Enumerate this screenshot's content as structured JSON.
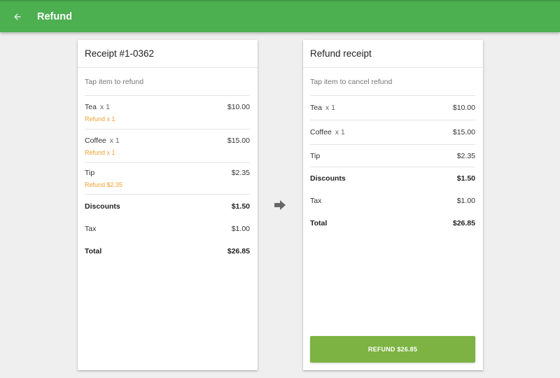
{
  "appbar": {
    "title": "Refund"
  },
  "receipt": {
    "title": "Receipt #1-0362",
    "hint": "Tap item to refund",
    "items": [
      {
        "name": "Tea",
        "qty": "x 1",
        "price": "$10.00",
        "refund": "Refund x 1"
      },
      {
        "name": "Coffee",
        "qty": "x 1",
        "price": "$15.00",
        "refund": "Refund x 1"
      }
    ],
    "tip": {
      "name": "Tip",
      "price": "$2.35",
      "refund": "Refund $2.35"
    },
    "discounts": {
      "label": "Discounts",
      "value": "$1.50"
    },
    "tax": {
      "label": "Tax",
      "value": "$1.00"
    },
    "total": {
      "label": "Total",
      "value": "$26.85"
    }
  },
  "refund_receipt": {
    "title": "Refund receipt",
    "hint": "Tap item to cancel refund",
    "items": [
      {
        "name": "Tea",
        "qty": "x 1",
        "price": "$10.00"
      },
      {
        "name": "Coffee",
        "qty": "x 1",
        "price": "$15.00"
      }
    ],
    "tip": {
      "name": "Tip",
      "price": "$2.35"
    },
    "discounts": {
      "label": "Discounts",
      "value": "$1.50"
    },
    "tax": {
      "label": "Tax",
      "value": "$1.00"
    },
    "total": {
      "label": "Total",
      "value": "$26.85"
    },
    "button_label": "REFUND $26.85"
  },
  "colors": {
    "appbar": "#4caf50",
    "refund_button": "#7cb342",
    "refund_note": "#f0a030"
  },
  "icons": {
    "back": "arrow-back-icon",
    "transfer": "arrow-right-icon"
  }
}
